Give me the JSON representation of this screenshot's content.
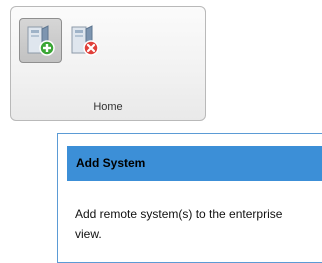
{
  "ribbon": {
    "group_label": "Home",
    "buttons": [
      {
        "icon": "add-system-icon",
        "state": "pressed"
      },
      {
        "icon": "remove-system-icon",
        "state": "normal"
      }
    ]
  },
  "tooltip": {
    "title": "Add System",
    "description": "Add remote system(s) to the enterprise view."
  },
  "colors": {
    "tooltip_header": "#3c8fd7",
    "tooltip_border": "#5b9bd5",
    "add_badge": "#3aa635",
    "remove_badge": "#e0403a"
  }
}
